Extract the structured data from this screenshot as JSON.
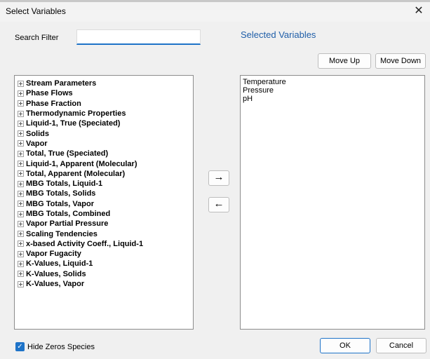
{
  "window": {
    "title": "Select Variables",
    "close_glyph": "✕"
  },
  "search": {
    "label": "Search Filter",
    "value": ""
  },
  "selected_panel": {
    "title": "Selected Variables",
    "items": [
      "Temperature",
      "Pressure",
      "pH"
    ]
  },
  "buttons": {
    "move_up": "Move Up",
    "move_down": "Move Down",
    "ok": "OK",
    "cancel": "Cancel",
    "add_arrow": "→",
    "remove_arrow": "←"
  },
  "tree": {
    "items": [
      "Stream Parameters",
      "Phase Flows",
      "Phase Fraction",
      "Thermodynamic Properties",
      "Liquid-1, True (Speciated)",
      "Solids",
      "Vapor",
      "Total, True (Speciated)",
      "Liquid-1, Apparent (Molecular)",
      "Total, Apparent (Molecular)",
      "MBG Totals, Liquid-1",
      "MBG Totals, Solids",
      "MBG Totals, Vapor",
      "MBG Totals, Combined",
      "Vapor Partial Pressure",
      "Scaling Tendencies",
      "x-based Activity Coeff., Liquid-1",
      "Vapor Fugacity",
      "K-Values, Liquid-1",
      "K-Values, Solids",
      "K-Values, Vapor"
    ]
  },
  "options": {
    "hide_zeros_label": "Hide Zeros Species",
    "hide_zeros_checked": true,
    "check_glyph": "✓"
  },
  "colors": {
    "accent": "#1e73c8",
    "title_blue": "#1f5ea8"
  }
}
